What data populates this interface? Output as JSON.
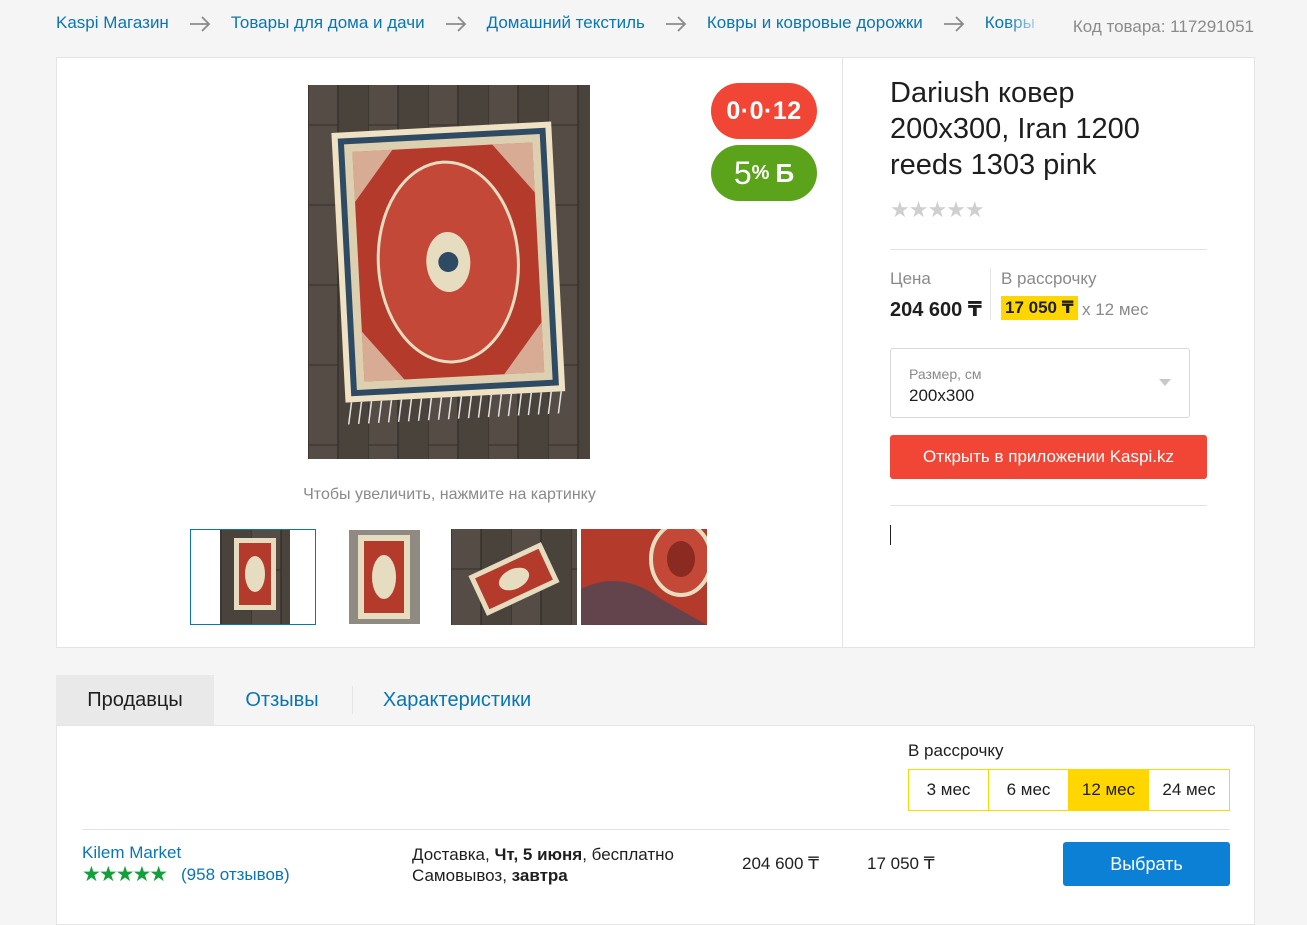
{
  "breadcrumb": {
    "items": [
      "Kaspi Магазин",
      "Товары для дома и дачи",
      "Домашний текстиль",
      "Ковры и ковровые дорожки",
      "Ковры"
    ]
  },
  "sku": "Код товара: 117291051",
  "gallery": {
    "zoom_hint": "Чтобы увеличить, нажмите на картинку",
    "badge_installment": "0·0·12",
    "badge_bonus_value": "5",
    "badge_bonus_pct": "%",
    "badge_bonus_symbol": "Б"
  },
  "product": {
    "title": "Dariush ковер 200x300, Iran 1200 reeds 1303 pink",
    "rating_stars": "★★★★★",
    "price_label": "Цена",
    "price": "204 600 ₸",
    "installment_label": "В рассрочку",
    "installment_amount": "17 050 ₸",
    "installment_term": "x 12 мес",
    "size_label": "Размер, см",
    "size_value": "200x300",
    "open_app_button": "Открыть в приложении Kaspi.kz"
  },
  "tabs": [
    "Продавцы",
    "Отзывы",
    "Характеристики"
  ],
  "sellers": {
    "installment_label": "В рассрочку",
    "terms": [
      "3 мес",
      "6 мес",
      "12 мес",
      "24 мес"
    ],
    "active_term": "12 мес",
    "rows": [
      {
        "name": "Kilem Market",
        "stars": "★★★★★",
        "reviews": "(958 отзывов)",
        "delivery_prefix": "Доставка, ",
        "delivery_date": "Чт, 5 июня",
        "delivery_suffix": ", бесплатно",
        "pickup_prefix": "Самовывоз, ",
        "pickup_date": "завтра",
        "price": "204 600 ₸",
        "installment": "17 050 ₸",
        "button": "Выбрать"
      }
    ]
  },
  "colors": {
    "link": "#0b75b3",
    "accent_red": "#f14635",
    "bonus_green": "#5aa31a",
    "highlight_yellow": "#ffd600",
    "primary_blue": "#0b80d4"
  }
}
